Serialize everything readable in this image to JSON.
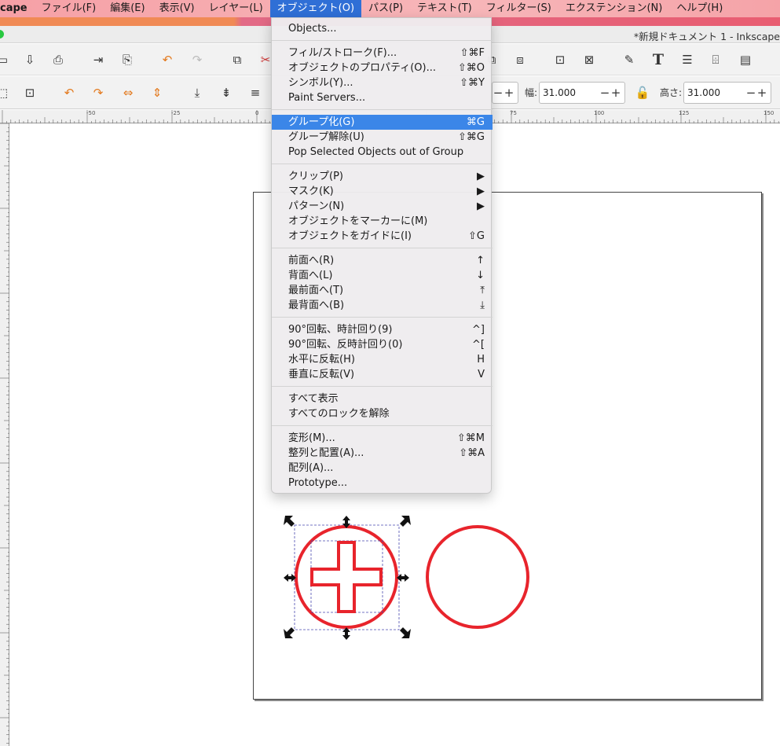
{
  "menubar": {
    "app": "cape",
    "items": [
      "ファイル(F)",
      "編集(E)",
      "表示(V)",
      "レイヤー(L)",
      "オブジェクト(O)",
      "パス(P)",
      "テキスト(T)",
      "フィルター(S)",
      "エクステンション(N)",
      "ヘルプ(H)"
    ],
    "active_index": 4
  },
  "window": {
    "title": "*新規ドキュメント 1 - Inkscape"
  },
  "toolbar2": {
    "width_label": "幅:",
    "width_value": "31.000",
    "height_label": "高さ:",
    "height_value": "31.000"
  },
  "ruler": {
    "top_labels": [
      "-50",
      "-25",
      "0",
      "75",
      "100",
      "125",
      "150"
    ]
  },
  "object_menu": {
    "items": [
      {
        "label": "Objects...",
        "shortcut": ""
      },
      {
        "label": "フィル/ストローク(F)...",
        "shortcut": "⇧⌘F"
      },
      {
        "label": "オブジェクトのプロパティ(O)...",
        "shortcut": "⇧⌘O"
      },
      {
        "label": "シンボル(Y)...",
        "shortcut": "⇧⌘Y"
      },
      {
        "label": "Paint Servers...",
        "shortcut": ""
      },
      {
        "label": "グループ化(G)",
        "shortcut": "⌘G"
      },
      {
        "label": "グループ解除(U)",
        "shortcut": "⇧⌘G"
      },
      {
        "label": "Pop Selected Objects out of Group",
        "shortcut": ""
      },
      {
        "label": "クリップ(P)",
        "shortcut": "▶"
      },
      {
        "label": "マスク(K)",
        "shortcut": "▶"
      },
      {
        "label": "パターン(N)",
        "shortcut": "▶"
      },
      {
        "label": "オブジェクトをマーカーに(M)",
        "shortcut": ""
      },
      {
        "label": "オブジェクトをガイドに(I)",
        "shortcut": "⇧G"
      },
      {
        "label": "前面へ(R)",
        "shortcut": "↑"
      },
      {
        "label": "背面へ(L)",
        "shortcut": "↓"
      },
      {
        "label": "最前面へ(T)",
        "shortcut": "⤒"
      },
      {
        "label": "最背面へ(B)",
        "shortcut": "⤓"
      },
      {
        "label": "90°回転、時計回り(9)",
        "shortcut": "^]"
      },
      {
        "label": "90°回転、反時計回り(0)",
        "shortcut": "^["
      },
      {
        "label": "水平に反転(H)",
        "shortcut": "H"
      },
      {
        "label": "垂直に反転(V)",
        "shortcut": "V"
      },
      {
        "label": "すべて表示",
        "shortcut": ""
      },
      {
        "label": "すべてのロックを解除",
        "shortcut": ""
      },
      {
        "label": "変形(M)...",
        "shortcut": "⇧⌘M"
      },
      {
        "label": "整列と配置(A)...",
        "shortcut": "⇧⌘A"
      },
      {
        "label": "配列(A)...",
        "shortcut": ""
      },
      {
        "label": "Prototype...",
        "shortcut": ""
      }
    ],
    "highlighted_index": 5
  },
  "colors": {
    "menubar": "#f6a0a6",
    "highlight": "#3b86e8",
    "stroke": "#e8242c"
  },
  "icons": [
    "open-icon",
    "import-icon",
    "print-icon",
    "export-icon",
    "undo-icon",
    "redo-icon",
    "copy-icon",
    "cut-icon",
    "group-icon",
    "ungroup-icon",
    "pen-icon",
    "text-tool-icon",
    "layers-icon",
    "xml-editor-icon",
    "align-icon",
    "lock-icon"
  ]
}
